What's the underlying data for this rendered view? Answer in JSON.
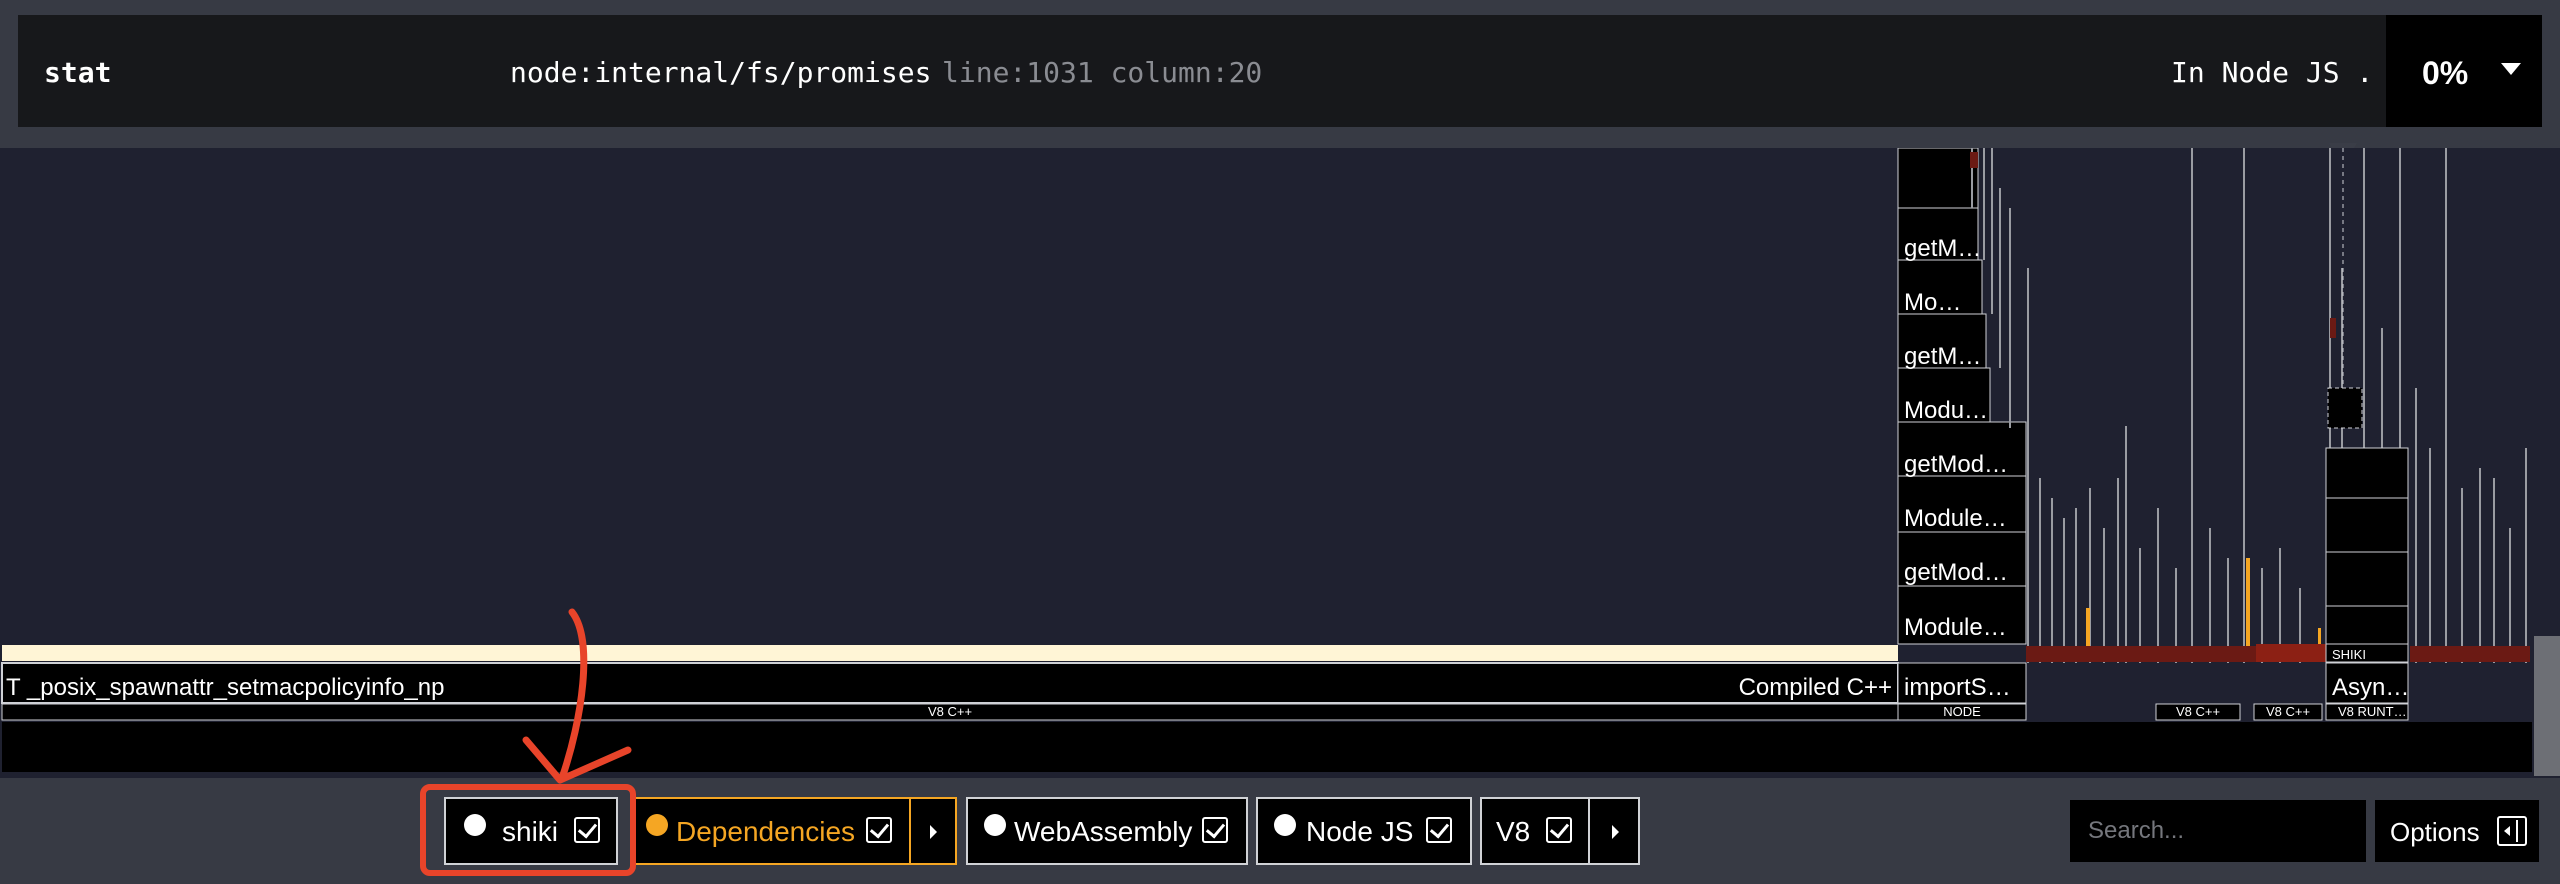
{
  "tooltip": {
    "name": "stat",
    "path": "node:internal/fs/promises",
    "location": "line:1031 column:20",
    "category": "In Node JS .",
    "percent": "0%"
  },
  "flame": {
    "left_frame_label": "T _posix_spawnattr_setmacpolicyinfo_np",
    "left_frame_type": "Compiled C++",
    "left_section_label": "V8 C++",
    "stack_labels": [
      "getM…",
      "Mo…",
      "getM…",
      "Modu…",
      "getMod…",
      "Module…",
      "getMod…",
      "Module…"
    ],
    "import_label": "importS…",
    "async_label": "Asyn…",
    "shiki_small": "SHIKI",
    "section_labels": {
      "node": "NODE",
      "v8cpp_a": "V8 C++",
      "v8cpp_b": "V8 C++",
      "v8runtime": "V8 RUNT…"
    },
    "colors": {
      "background": "#1f2130",
      "frame": "#000000",
      "highlight_frame": "#fff5d6",
      "dependency": "#f5a623",
      "dark_red": "#6b1a14"
    }
  },
  "filters": [
    {
      "label": "shiki",
      "checked": true,
      "color": "#ffffff"
    },
    {
      "label": "Dependencies",
      "checked": true,
      "color": "#f5a623"
    },
    {
      "label": "WebAssembly",
      "checked": true,
      "color": "#ffffff"
    },
    {
      "label": "Node JS",
      "checked": true,
      "color": "#ffffff"
    },
    {
      "label": "V8",
      "checked": true,
      "color": "#ffffff"
    }
  ],
  "search": {
    "placeholder": "Search..."
  },
  "options": {
    "label": "Options"
  },
  "annotation_color": "#e8442a"
}
